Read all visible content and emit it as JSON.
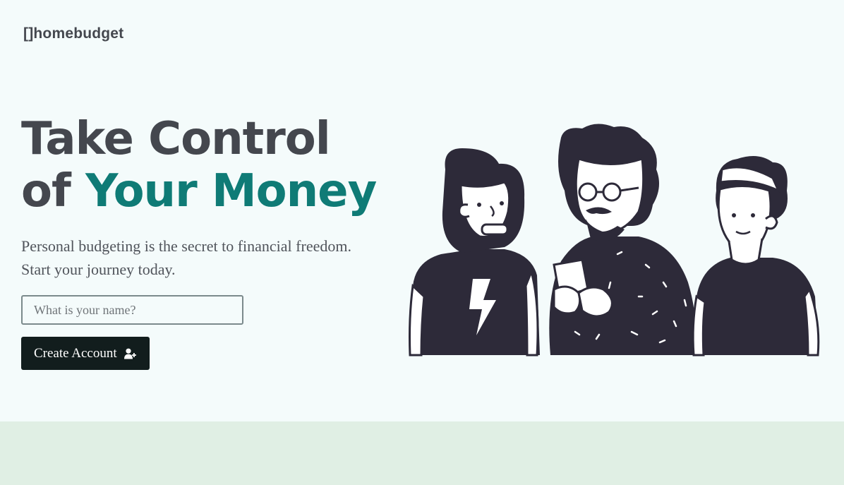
{
  "brand": {
    "name": "[]homebudget"
  },
  "hero": {
    "headline_line1": "Take Control",
    "headline_of": "of ",
    "headline_accent": "Your Money",
    "subtitle": "Personal budgeting is the secret to financial freedom. Start your journey today."
  },
  "form": {
    "name_placeholder": "What is your name?",
    "name_value": "",
    "submit_label": "Create Account",
    "submit_icon": "user-plus-icon"
  },
  "colors": {
    "background": "#f4fbfb",
    "accent": "#0f7b76",
    "button": "#121d1d",
    "footer_band": "#e0efe4"
  }
}
